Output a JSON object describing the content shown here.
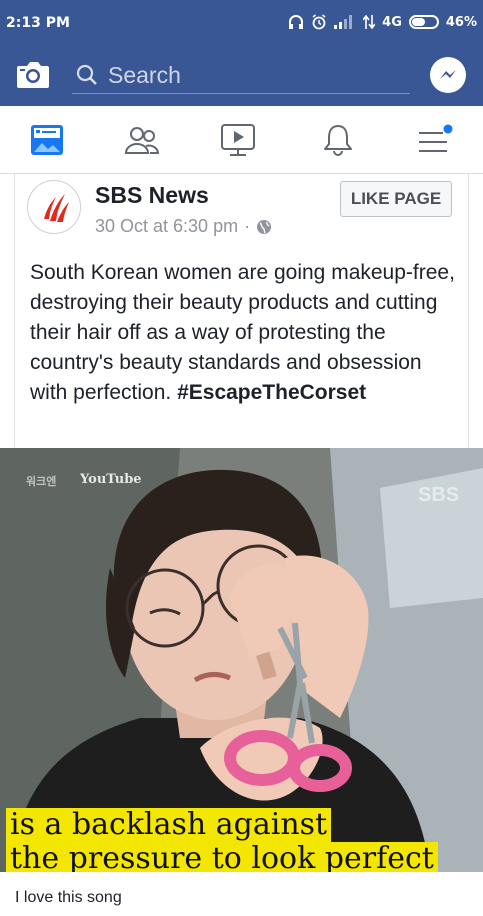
{
  "status_bar": {
    "time": "2:13 PM",
    "network": "4G",
    "battery": "46%"
  },
  "search_bar": {
    "placeholder": "Search"
  },
  "nav_tabs": [
    "news-feed",
    "friends",
    "watch",
    "notifications",
    "menu"
  ],
  "post": {
    "page_name": "SBS News",
    "timestamp": "30 Oct at 6:30 pm",
    "separator": "·",
    "like_label": "LIKE PAGE",
    "text": "South Korean women are going makeup-free, destroying their beauty products and cutting their hair off as a way of protesting the country's beauty standards and obsession with perfection. ",
    "hashtag": "#EscapeTheCorset"
  },
  "video": {
    "source_label": "YouTube",
    "channel_label": "워크엔",
    "watermark": "SBS",
    "caption_line_1": "is a backlash against",
    "caption_line_2": "the pressure to look perfect"
  },
  "comment": "I love this song",
  "colors": {
    "facebook_blue": "#3a5795",
    "notification_dot": "#1877f2",
    "caption_yellow": "#f3e600",
    "sbs_red": "#e3281c"
  }
}
